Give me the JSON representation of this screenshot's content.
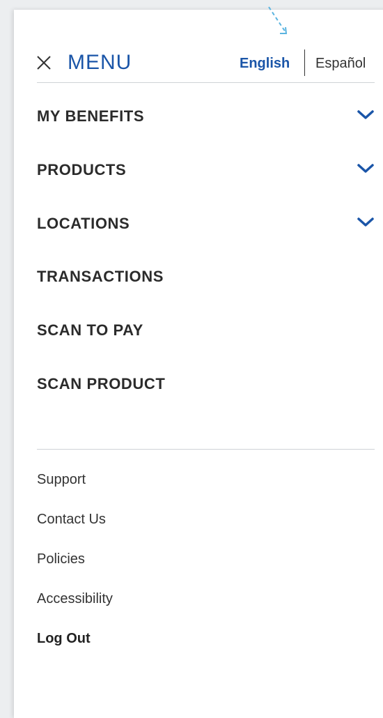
{
  "header": {
    "title": "MENU",
    "close_icon": "close-icon",
    "languages": {
      "active": "English",
      "inactive": "Español"
    }
  },
  "nav": {
    "items": [
      {
        "label": "MY BENEFITS",
        "expandable": true
      },
      {
        "label": "PRODUCTS",
        "expandable": true
      },
      {
        "label": "LOCATIONS",
        "expandable": true
      },
      {
        "label": "TRANSACTIONS",
        "expandable": false
      },
      {
        "label": "SCAN TO PAY",
        "expandable": false
      },
      {
        "label": "SCAN PRODUCT",
        "expandable": false
      }
    ]
  },
  "footer": {
    "links": [
      "Support",
      "Contact Us",
      "Policies",
      "Accessibility"
    ],
    "logout": "Log Out"
  },
  "colors": {
    "accent": "#1a55a8",
    "text": "#2b2b2b",
    "divider": "#cfd2d6",
    "hint_arrow": "#5ab4e0"
  }
}
